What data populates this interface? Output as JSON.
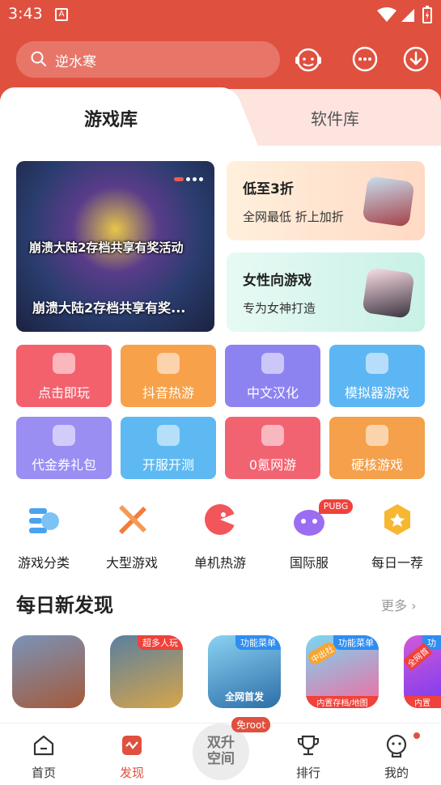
{
  "status": {
    "time": "3:43",
    "a_icon": "A"
  },
  "search": {
    "text": "逆水寒"
  },
  "header_icons": [
    "customer-service-icon",
    "message-icon",
    "download-icon"
  ],
  "tabs": [
    {
      "label": "游戏库",
      "active": true
    },
    {
      "label": "软件库",
      "active": false
    }
  ],
  "banner": {
    "overlay_title": "崩溃大陆2存档共享有奖活动",
    "caption": "崩溃大陆2存档共享有奖..."
  },
  "promos": [
    {
      "title": "低至3折",
      "subtitle": "全网最低 折上加折"
    },
    {
      "title": "女性向游戏",
      "subtitle": "专为女神打造"
    }
  ],
  "tiles": [
    {
      "label": "点击即玩",
      "color": "#f3616d"
    },
    {
      "label": "抖音热游",
      "color": "#f7a14a"
    },
    {
      "label": "中文汉化",
      "color": "#8d83f0"
    },
    {
      "label": "模拟器游戏",
      "color": "#5db6f4"
    },
    {
      "label": "代金券礼包",
      "color": "#9a8ef2"
    },
    {
      "label": "开服开测",
      "color": "#5eb9f2"
    },
    {
      "label": "0氪网游",
      "color": "#f26371"
    },
    {
      "label": "硬核游戏",
      "color": "#f5a04a"
    }
  ],
  "categories": [
    {
      "label": "游戏分类",
      "icon": "game-category-icon"
    },
    {
      "label": "大型游戏",
      "icon": "large-game-icon"
    },
    {
      "label": "单机热游",
      "icon": "single-player-icon"
    },
    {
      "label": "国际服",
      "icon": "international-icon",
      "badge": "PUBG"
    },
    {
      "label": "每日一荐",
      "icon": "daily-pick-icon"
    }
  ],
  "section": {
    "title": "每日新发现",
    "more": "更多"
  },
  "games": [
    {
      "tag": "",
      "bottom": ""
    },
    {
      "tag": "超多人玩",
      "bottom": ""
    },
    {
      "tag": "功能菜单",
      "bottom": "全网首发"
    },
    {
      "tag": "功能菜单",
      "bottom": "内置存档/地图",
      "side": "中出社"
    },
    {
      "tag": "功",
      "bottom": "内置",
      "side": "全网首"
    }
  ],
  "nav": [
    {
      "label": "首页",
      "icon": "home-icon"
    },
    {
      "label": "发现",
      "icon": "discover-icon",
      "active": true
    },
    {
      "label": "双升空间",
      "badge": "免root"
    },
    {
      "label": "排行",
      "icon": "trophy-icon"
    },
    {
      "label": "我的",
      "icon": "profile-icon"
    }
  ]
}
